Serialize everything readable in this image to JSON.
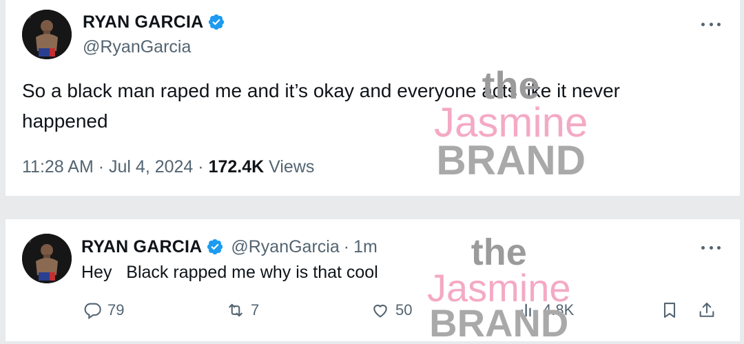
{
  "tweet1": {
    "display_name": "RYAN GARCIA",
    "handle": "@RyanGarcia",
    "text": "So a black man raped me and it’s okay and everyone acts like it never happened",
    "time": "11:28 AM",
    "date": "Jul 4, 2024",
    "views_count": "172.4K",
    "views_label": "Views",
    "separator": "·"
  },
  "tweet2": {
    "display_name": "RYAN GARCIA",
    "handle": "@RyanGarcia",
    "separator": "·",
    "relative_time": "1m",
    "text": "Hey   Black rapped me why is that cool",
    "replies": "79",
    "reposts": "7",
    "likes": "50",
    "views": "4.8K"
  },
  "watermark": {
    "line1": "the",
    "line2": "Jasmine",
    "line3": "BRAND"
  },
  "colors": {
    "verified": "#1d9bf0",
    "secondary_text": "#536471",
    "primary_text": "#0f1419",
    "watermark_pink": "#f4a9c4",
    "watermark_gray": "#a9a9a9"
  }
}
